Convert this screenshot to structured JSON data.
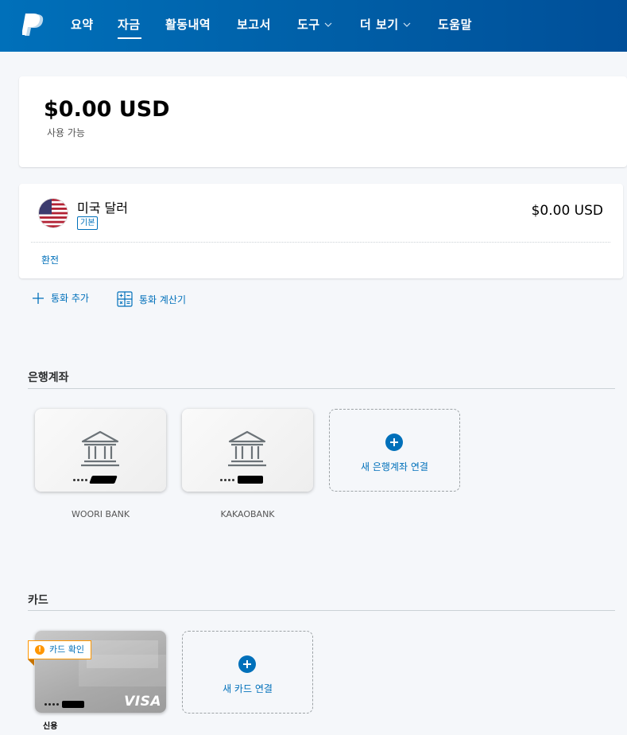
{
  "nav": {
    "items": [
      {
        "label": "요약",
        "dropdown": false
      },
      {
        "label": "자금",
        "dropdown": false,
        "active": true
      },
      {
        "label": "활동내역",
        "dropdown": false
      },
      {
        "label": "보고서",
        "dropdown": false
      },
      {
        "label": "도구",
        "dropdown": true
      },
      {
        "label": "더 보기",
        "dropdown": true
      },
      {
        "label": "도움말",
        "dropdown": false
      }
    ],
    "brand_color": "#0070ba"
  },
  "balance": {
    "amount": "$0.00 USD",
    "subtitle": "사용 가능"
  },
  "currency": {
    "name": "미국 달러",
    "badge": "기본",
    "amount": "$0.00 USD",
    "exchange_link": "환전"
  },
  "actions": {
    "add_currency": "통화 추가",
    "calculator": "통화 계산기"
  },
  "bank_section": {
    "title": "은행계좌",
    "accounts": [
      {
        "name": "WOORI BANK",
        "icon": "bank-icon"
      },
      {
        "name": "KAKAOBANK",
        "icon": "bank-icon"
      }
    ],
    "add_label": "새 은행계좌 연결"
  },
  "card_section": {
    "title": "카드",
    "card": {
      "brand": "VISA",
      "status": "카드 확인",
      "type": "신용"
    },
    "add_label": "새 카드 연결"
  }
}
